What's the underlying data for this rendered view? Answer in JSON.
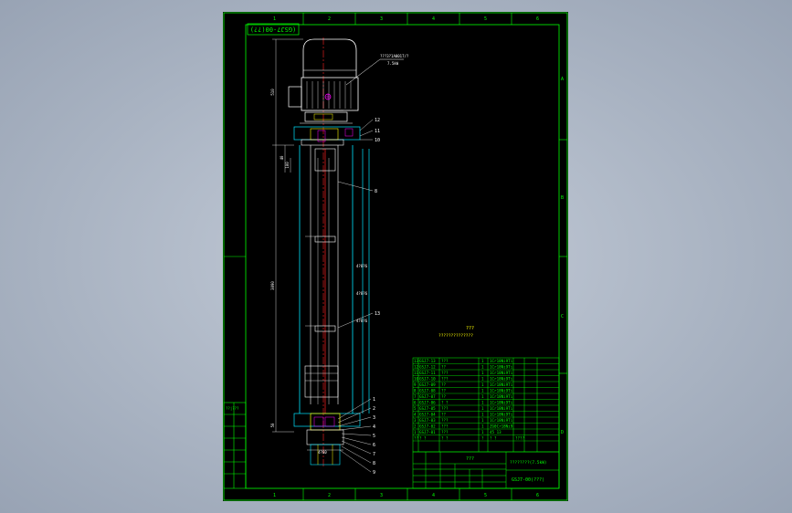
{
  "drawing_code_box": "(GSJ7-00(??)",
  "motor_callout": "???3?1A0017/?",
  "motor_callout_sub": "7.5kW",
  "zone_letters_top": [
    "1",
    "2",
    "3",
    "4",
    "5",
    "6"
  ],
  "zone_letters_side": [
    "A",
    "B",
    "C",
    "D"
  ],
  "dims_left": [
    "510",
    "3090",
    "40",
    "100",
    "50"
  ],
  "dims_right": [
    "4?8?6",
    "4?8?6",
    "4?8?6"
  ],
  "dim_bottom": "4?60",
  "notes_title": "???",
  "notes_line": "??????????????",
  "balloons_right_top": [
    "12",
    "11",
    "10"
  ],
  "balloon_mid": "8",
  "balloon_lower": "13",
  "balloons_bottom": [
    "1",
    "2",
    "3",
    "4",
    "5",
    "6",
    "7",
    "8",
    "9"
  ],
  "bom": [
    {
      "no": "13",
      "code": "GSJ7-13",
      "name": "???",
      "qty": "1",
      "material": "1Cr18Ni9Ti"
    },
    {
      "no": "12",
      "code": "GSJ7-12",
      "name": "??",
      "qty": "1",
      "material": "1Cr18Ni9Ti"
    },
    {
      "no": "11",
      "code": "GSJ7-11",
      "name": "???",
      "qty": "1",
      "material": "1Cr18Ni9Ti"
    },
    {
      "no": "10",
      "code": "GSJ7-10",
      "name": "???",
      "qty": "1",
      "material": "1Cr18Ni9Ti"
    },
    {
      "no": "9",
      "code": "GSJ7-09",
      "name": "??",
      "qty": "1",
      "material": "1Cr18Ni9Ti"
    },
    {
      "no": "8",
      "code": "GSJ7-08",
      "name": "??",
      "qty": "1",
      "material": "1Cr18Ni9Ti"
    },
    {
      "no": "7",
      "code": "GSJ7-07",
      "name": "??",
      "qty": "1",
      "material": "1Cr18Ni9Ti"
    },
    {
      "no": "6",
      "code": "GSJ7-06",
      "name": "? ?",
      "qty": "1",
      "material": "1Cr18Ni9Ti"
    },
    {
      "no": "5",
      "code": "GSJ7-05",
      "name": "???",
      "qty": "1",
      "material": "1Cr18Ni9Ti"
    },
    {
      "no": "4",
      "code": "GSJ7-04",
      "name": "??",
      "qty": "1",
      "material": "1Cr18Ni9Ti"
    },
    {
      "no": "3",
      "code": "GSJ7-03",
      "name": "???",
      "qty": "1",
      "material": "1Cr18Ni9Ti"
    },
    {
      "no": "2",
      "code": "GSJ7-02",
      "name": "???",
      "qty": "1",
      "material": "ZG0Cr18Ni9"
    },
    {
      "no": "1",
      "code": "GSJ7-01",
      "name": "???",
      "qty": "1",
      "material": "45 13"
    }
  ],
  "bom_header": {
    "no": "??",
    "code": "? ?",
    "name": "? ?",
    "qty": "?",
    "material": "? ?",
    "extra": "????"
  },
  "title_block": {
    "company": "???",
    "product": "????????(7.5kW)",
    "drawing_no": "GSJ7-00(???)"
  },
  "side_panel_label": "??|???"
}
